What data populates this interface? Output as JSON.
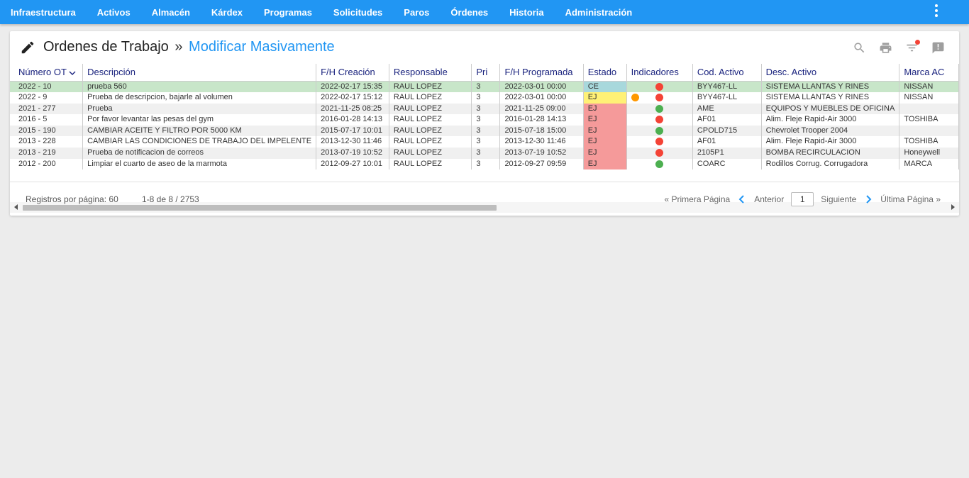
{
  "nav": {
    "items": [
      "Infraestructura",
      "Activos",
      "Almacén",
      "Kárdex",
      "Programas",
      "Solicitudes",
      "Paros",
      "Órdenes",
      "Historia",
      "Administración"
    ]
  },
  "header": {
    "title": "Ordenes de Trabajo",
    "separator": "»",
    "subtitle": "Modificar Masivamente"
  },
  "table": {
    "columns": [
      "Número OT",
      "Descripción",
      "F/H Creación",
      "Responsable",
      "Pri",
      "F/H Programada",
      "Estado",
      "Indicadores",
      "Cod. Activo",
      "Desc. Activo",
      "Marca AC"
    ],
    "rows": [
      {
        "ot": "2022 - 10",
        "desc": "prueba 560",
        "creacion": "2022-02-17 15:35",
        "responsable": "RAUL LOPEZ",
        "pri": "3",
        "programada": "2022-03-01 00:00",
        "estado": "CE",
        "estado_color": "#a8d8dc",
        "indicadores": [
          "red"
        ],
        "cod": "BYY467-LL",
        "desc_activo": "SISTEMA LLANTAS Y RINES",
        "marca": "NISSAN"
      },
      {
        "ot": "2022 - 9",
        "desc": "Prueba de descripcion, bajarle al volumen",
        "creacion": "2022-02-17 15:12",
        "responsable": "RAUL LOPEZ",
        "pri": "3",
        "programada": "2022-03-01 00:00",
        "estado": "EJ",
        "estado_color": "#fff176",
        "indicadores": [
          "orange",
          "red"
        ],
        "cod": "BYY467-LL",
        "desc_activo": "SISTEMA LLANTAS Y RINES",
        "marca": "NISSAN"
      },
      {
        "ot": "2021 - 277",
        "desc": "Prueba",
        "creacion": "2021-11-25 08:25",
        "responsable": "RAUL LOPEZ",
        "pri": "3",
        "programada": "2021-11-25 09:00",
        "estado": "EJ",
        "estado_color": "#f59a9a",
        "indicadores": [
          "green"
        ],
        "cod": "AME",
        "desc_activo": "EQUIPOS Y MUEBLES DE OFICINA",
        "marca": ""
      },
      {
        "ot": "2016 - 5",
        "desc": "Por favor levantar las pesas del gym",
        "creacion": "2016-01-28 14:13",
        "responsable": "RAUL LOPEZ",
        "pri": "3",
        "programada": "2016-01-28 14:13",
        "estado": "EJ",
        "estado_color": "#f59a9a",
        "indicadores": [
          "red"
        ],
        "cod": "AF01",
        "desc_activo": "Alim. Fleje Rapid-Air 3000",
        "marca": "TOSHIBA"
      },
      {
        "ot": "2015 - 190",
        "desc": "CAMBIAR ACEITE Y FILTRO POR 5000 KM",
        "creacion": "2015-07-17 10:01",
        "responsable": "RAUL LOPEZ",
        "pri": "3",
        "programada": "2015-07-18 15:00",
        "estado": "EJ",
        "estado_color": "#f59a9a",
        "indicadores": [
          "green"
        ],
        "cod": "CPOLD715",
        "desc_activo": "Chevrolet Trooper 2004",
        "marca": ""
      },
      {
        "ot": "2013 - 228",
        "desc": "CAMBIAR LAS CONDICIONES DE TRABAJO DEL IMPELENTE",
        "creacion": "2013-12-30 11:46",
        "responsable": "RAUL LOPEZ",
        "pri": "3",
        "programada": "2013-12-30 11:46",
        "estado": "EJ",
        "estado_color": "#f59a9a",
        "indicadores": [
          "red"
        ],
        "cod": "AF01",
        "desc_activo": "Alim. Fleje Rapid-Air 3000",
        "marca": "TOSHIBA"
      },
      {
        "ot": "2013 - 219",
        "desc": "Prueba de notificacion de correos",
        "creacion": "2013-07-19 10:52",
        "responsable": "RAUL LOPEZ",
        "pri": "3",
        "programada": "2013-07-19 10:52",
        "estado": "EJ",
        "estado_color": "#f59a9a",
        "indicadores": [
          "red"
        ],
        "cod": "2105P1",
        "desc_activo": "BOMBA RECIRCULACION",
        "marca": "Honeywell"
      },
      {
        "ot": "2012 - 200",
        "desc": "Limpiar el cuarto de aseo de la marmota",
        "creacion": "2012-09-27 10:01",
        "responsable": "RAUL LOPEZ",
        "pri": "3",
        "programada": "2012-09-27 09:59",
        "estado": "EJ",
        "estado_color": "#f59a9a",
        "indicadores": [
          "green"
        ],
        "cod": "COARC",
        "desc_activo": "Rodillos Corrug. Corrugadora",
        "marca": "MARCA"
      }
    ]
  },
  "indicator_colors": {
    "red": "#f44336",
    "green": "#4caf50",
    "orange": "#ff9800"
  },
  "footer": {
    "per_page": "Registros por página: 60",
    "range": "1-8 de 8 / 2753",
    "first": "« Primera Página",
    "prev": "Anterior",
    "page": "1",
    "next": "Siguiente",
    "last": "Última Página »"
  },
  "icons": {
    "edit": "pencil-icon",
    "search": "search-icon",
    "print": "print-icon",
    "filter": "filter-icon",
    "comment": "comment-alert-icon",
    "menu": "more-vert-icon"
  },
  "colors": {
    "primary": "#2196f3",
    "selected_row": "#c8e6c9"
  }
}
